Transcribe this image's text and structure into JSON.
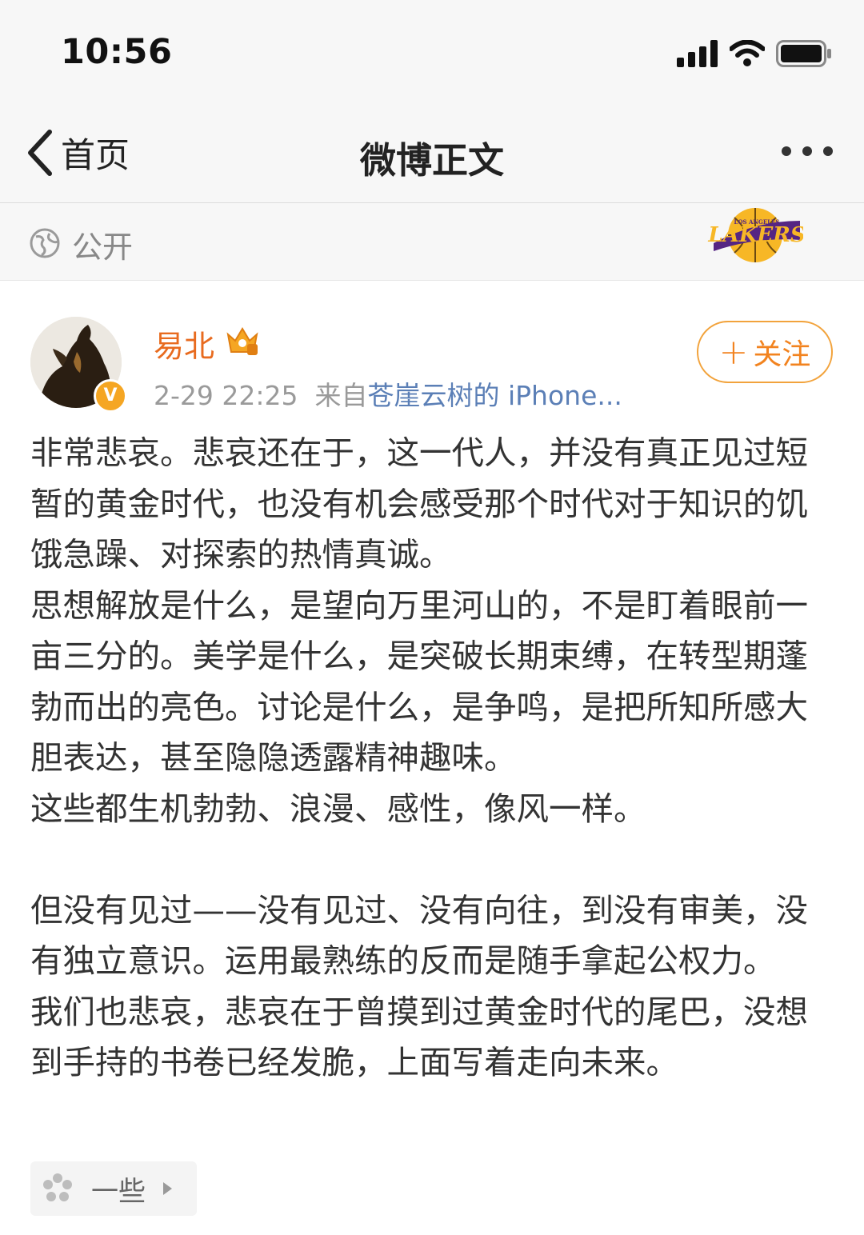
{
  "status_bar": {
    "time": "10:56"
  },
  "nav": {
    "back_label": "首页",
    "title": "微博正文"
  },
  "visibility": {
    "label": "公开"
  },
  "post": {
    "user_name": "易北",
    "verified_badge": "V",
    "timestamp": "2-29 22:25",
    "source_prefix": "来自",
    "source": "苍崖云树的 iPhone...",
    "follow_label": "关注",
    "paragraphs": [
      "非常悲哀。悲哀还在于，这一代人，并没有真正见过短暂的黄金时代，也没有机会感受那个时代对于知识的饥饿急躁、对探索的热情真诚。",
      "思想解放是什么，是望向万里河山的，不是盯着眼前一亩三分的。美学是什么，是突破长期束缚，在转型期蓬勃而出的亮色。讨论是什么，是争鸣，是把所知所感大胆表达，甚至隐隐透露精神趣味。",
      "这些都生机勃勃、浪漫、感性，像风一样。",
      "",
      "但没有见过——没有见过、没有向往，到没有审美，没有独立意识。运用最熟练的反而是随手拿起公权力。",
      "我们也悲哀，悲哀在于曾摸到过黄金时代的尾巴，没想到手持的书卷已经发脆，上面写着走向未来。"
    ],
    "topic_label": "一些"
  },
  "icons": {
    "back": "chevron-left-icon",
    "more": "more-dots-icon",
    "globe": "globe-icon",
    "lakers": "lakers-logo",
    "crown": "crown-icon",
    "topic": "flower-icon"
  },
  "colors": {
    "accent": "#f2831f",
    "username": "#e86b1f",
    "link": "#5b7fb6",
    "bar_bg": "#f7f7f7"
  }
}
